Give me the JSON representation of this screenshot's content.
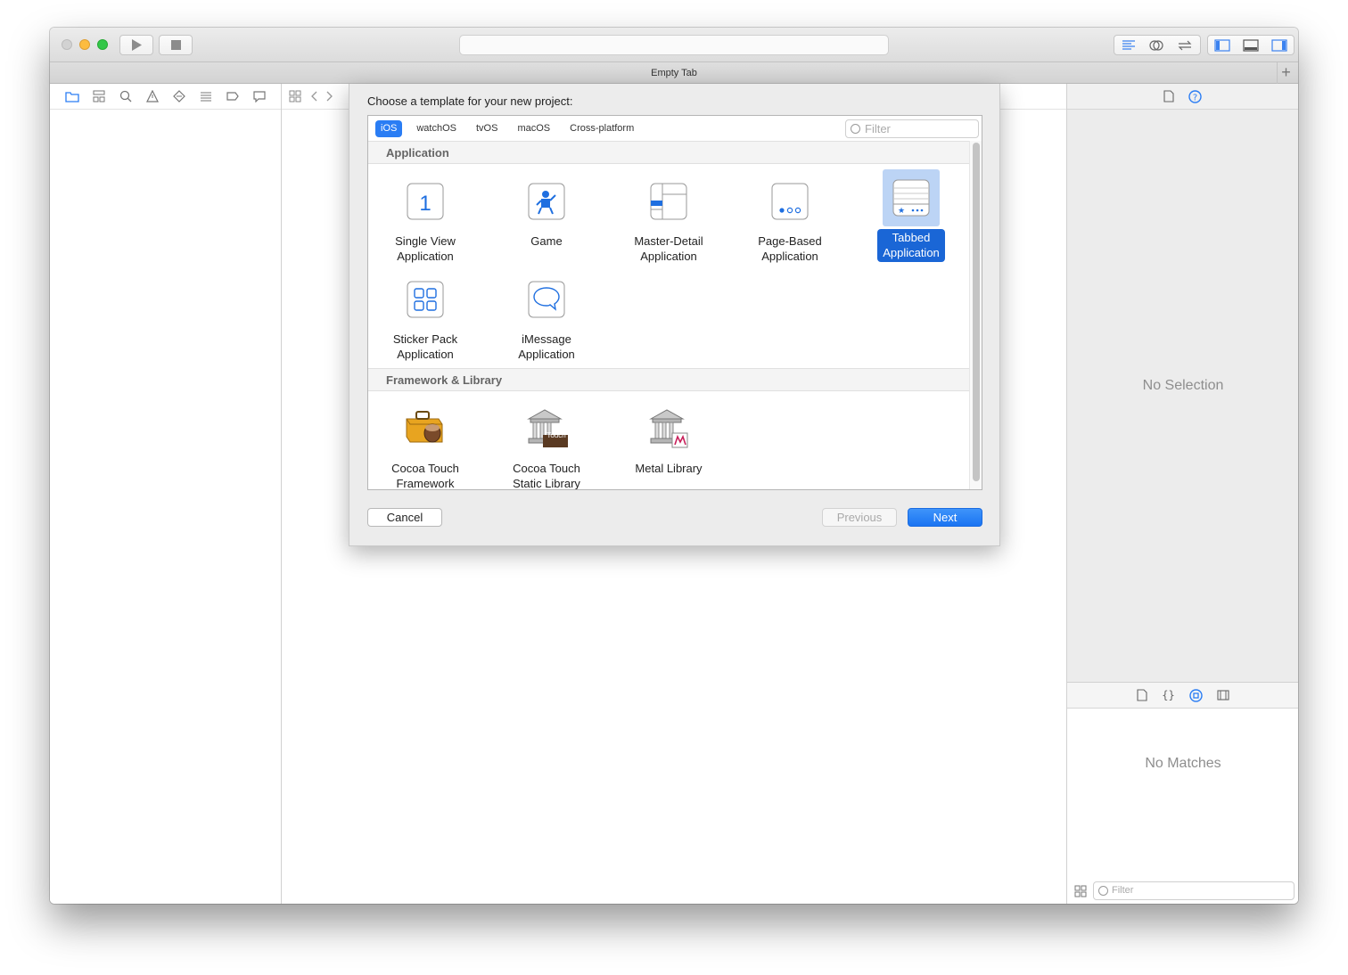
{
  "window": {
    "tab_title": "Empty Tab",
    "tab_add": "+"
  },
  "navigator_icons": [
    "folder-icon",
    "hierarchy-icon",
    "search-icon",
    "warning-icon",
    "test-icon",
    "debug-icon",
    "breakpoint-icon",
    "report-icon"
  ],
  "sheet": {
    "title": "Choose a template for your new project:",
    "platforms": [
      "iOS",
      "watchOS",
      "tvOS",
      "macOS",
      "Cross-platform"
    ],
    "active_platform": "iOS",
    "filter_placeholder": "Filter",
    "sections": [
      {
        "title": "Application"
      },
      {
        "title": "Framework & Library"
      }
    ],
    "templates": {
      "single_view": [
        "Single View",
        "Application"
      ],
      "game": [
        "Game",
        ""
      ],
      "master_detail": [
        "Master-Detail",
        "Application"
      ],
      "page_based": [
        "Page-Based",
        "Application"
      ],
      "tabbed": [
        "Tabbed",
        "Application"
      ],
      "sticker_pack": [
        "Sticker Pack",
        "Application"
      ],
      "imessage": [
        "iMessage",
        "Application"
      ],
      "cocoa_framework": [
        "Cocoa Touch",
        "Framework"
      ],
      "cocoa_static": [
        "Cocoa Touch",
        "Static Library"
      ],
      "metal_library": [
        "Metal Library",
        ""
      ]
    },
    "selected_template": "Tabbed Application",
    "static_badge": "Touch",
    "single_view_glyph": "1",
    "buttons": {
      "cancel": "Cancel",
      "previous": "Previous",
      "next": "Next"
    }
  },
  "inspector": {
    "no_selection": "No Selection",
    "no_matches": "No Matches",
    "filter_placeholder": "Filter",
    "braces_glyph": "{}"
  },
  "colors": {
    "accent": "#1a74f2",
    "selection": "#1a66d6"
  }
}
